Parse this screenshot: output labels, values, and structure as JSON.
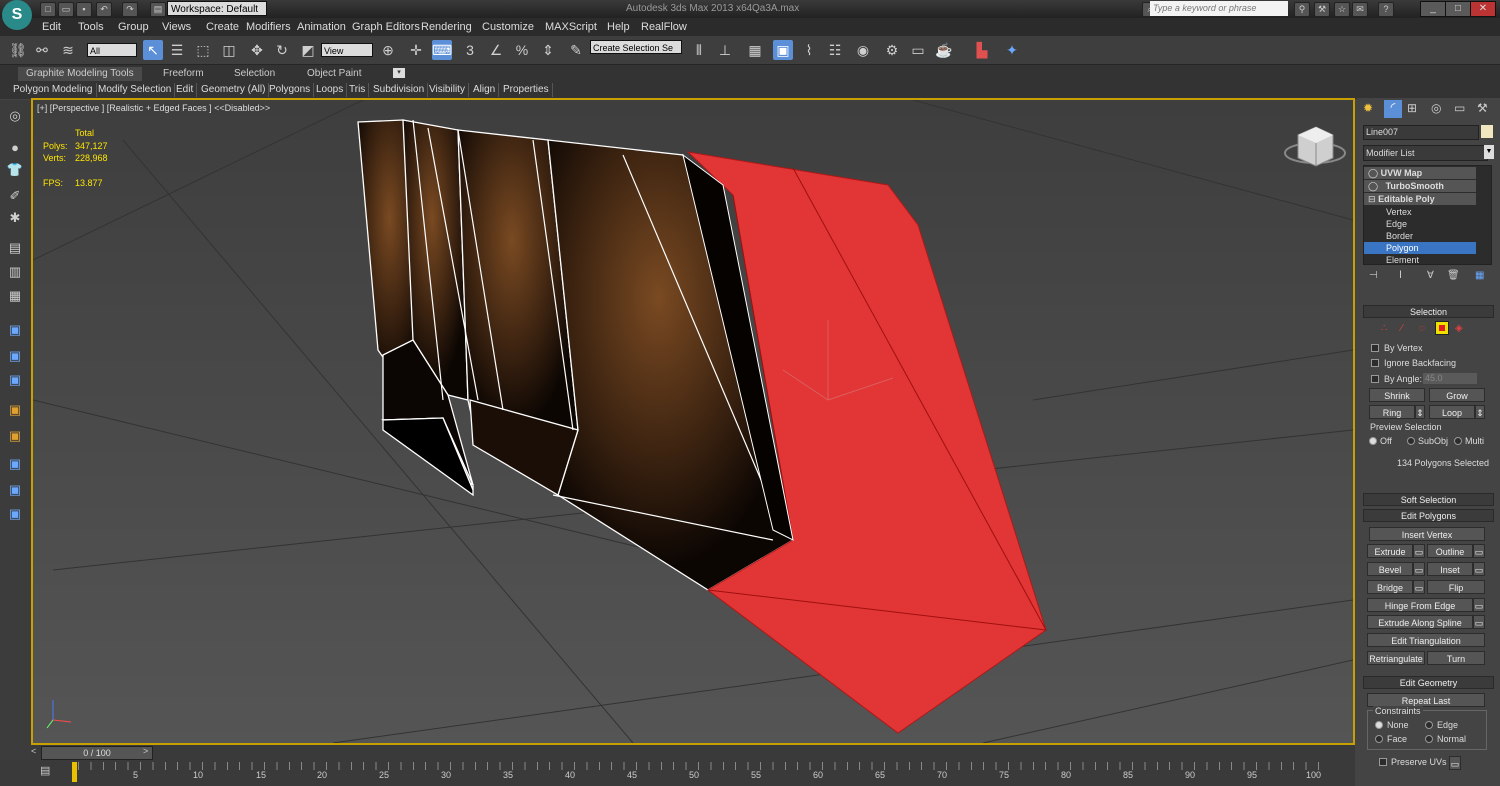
{
  "titlebar": {
    "workspace": "Workspace: Default",
    "app_title": "Autodesk 3ds Max  2013 x64",
    "file_name": "Qa3A.max",
    "search_placeholder": "Type a keyword or phrase"
  },
  "menu": [
    "Edit",
    "Tools",
    "Group",
    "Views",
    "Create",
    "Modifiers",
    "Animation",
    "Graph Editors",
    "Rendering",
    "Customize",
    "MAXScript",
    "Help",
    "RealFlow"
  ],
  "toolbar": {
    "selection_filter": "All",
    "ref_coord": "View",
    "named_selection_placeholder": "Create Selection Se"
  },
  "ribbon": {
    "tabs": [
      "Graphite Modeling Tools",
      "Freeform",
      "Selection",
      "Object Paint"
    ],
    "panels": [
      "Polygon Modeling",
      "Modify Selection",
      "Edit",
      "Geometry (All)",
      "Polygons",
      "Loops",
      "Tris",
      "Subdivision",
      "Visibility",
      "Align",
      "Properties"
    ]
  },
  "viewport": {
    "label": "[+] [Perspective ] [Realistic + Edged Faces ]  <<Disabled>>",
    "stats_header": "Total",
    "polys_label": "Polys:",
    "polys_value": "347,127",
    "verts_label": "Verts:",
    "verts_value": "228,968",
    "fps_label": "FPS:",
    "fps_value": "13.877"
  },
  "timeline": {
    "frame_display": "0 / 100",
    "ticks": [
      "5",
      "10",
      "15",
      "20",
      "25",
      "30",
      "35",
      "40",
      "45",
      "50",
      "55",
      "60",
      "65",
      "70",
      "75",
      "80",
      "85",
      "90",
      "95",
      "100"
    ]
  },
  "command_panel": {
    "object_name": "Line007",
    "modifier_list": "Modifier List",
    "stack": [
      "UVW Map",
      "TurboSmooth",
      "Editable Poly",
      "Vertex",
      "Edge",
      "Border",
      "Polygon",
      "Element"
    ],
    "selected_stack": "Polygon",
    "selection_rollout": "Selection",
    "by_vertex": "By Vertex",
    "ignore_backfacing": "Ignore Backfacing",
    "by_angle": "By Angle:",
    "angle_value": "45.0",
    "shrink": "Shrink",
    "grow": "Grow",
    "ring": "Ring",
    "loop": "Loop",
    "preview_selection": "Preview Selection",
    "preview_off": "Off",
    "preview_subobj": "SubObj",
    "preview_multi": "Multi",
    "selected_count": "134 Polygons Selected",
    "soft_selection": "Soft Selection",
    "edit_polygons": "Edit Polygons",
    "insert_vertex": "Insert Vertex",
    "extrude": "Extrude",
    "outline": "Outline",
    "bevel": "Bevel",
    "inset": "Inset",
    "bridge": "Bridge",
    "flip": "Flip",
    "hinge_from_edge": "Hinge From Edge",
    "extrude_along_spline": "Extrude Along Spline",
    "edit_triangulation": "Edit Triangulation",
    "retriangulate": "Retriangulate",
    "turn": "Turn",
    "edit_geometry": "Edit Geometry",
    "repeat_last": "Repeat Last",
    "constraints": "Constraints",
    "c_none": "None",
    "c_edge": "Edge",
    "c_face": "Face",
    "c_normal": "Normal",
    "preserve_uvs": "Preserve UVs"
  },
  "colors": {
    "selected_face": "#e23535",
    "viewport_border": "#c8a000",
    "stat_text": "#ffe600"
  }
}
